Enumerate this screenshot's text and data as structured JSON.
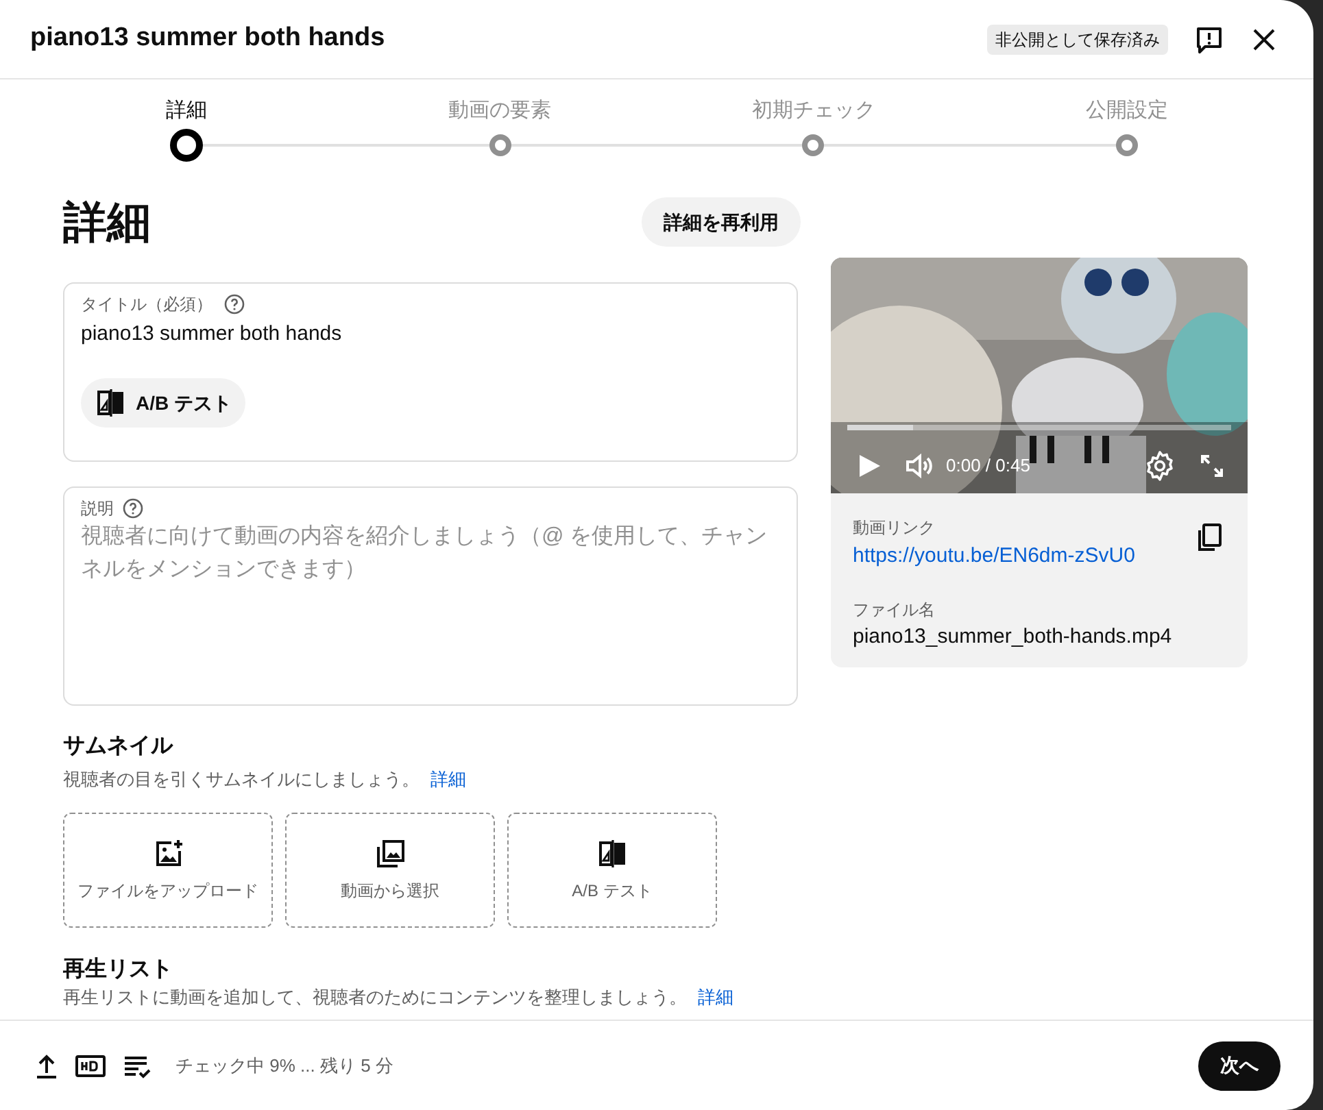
{
  "dialog": {
    "title": "piano13 summer both hands",
    "badge": "非公開として保存済み"
  },
  "steps": [
    {
      "label": "詳細",
      "selected": true
    },
    {
      "label": "動画の要素",
      "selected": false
    },
    {
      "label": "初期チェック",
      "selected": false
    },
    {
      "label": "公開設定",
      "selected": false
    }
  ],
  "heading": "詳細",
  "reuse_button": "詳細を再利用",
  "title_field": {
    "label": "タイトル（必須）",
    "value": "piano13 summer both hands",
    "ab_button": "A/B テスト"
  },
  "description_field": {
    "label": "説明",
    "placeholder": "視聴者に向けて動画の内容を紹介しましょう（@ を使用して、チャンネルをメンションできます）"
  },
  "video": {
    "time": "0:00 / 0:45",
    "progress": {
      "level": 0.17
    },
    "link_label": "動画リンク",
    "link": "https://youtu.be/EN6dm-zSvU0",
    "file_label": "ファイル名",
    "file_name": "piano13_summer_both-hands.mp4"
  },
  "thumbnail": {
    "heading": "サムネイル",
    "description": "視聴者の目を引くサムネイルにしましょう。",
    "more_link": "詳細",
    "options": [
      {
        "kind": "upload",
        "label": "ファイルをアップロード"
      },
      {
        "kind": "from_video",
        "label": "動画から選択"
      },
      {
        "kind": "ab_test",
        "label": "A/B テスト"
      }
    ]
  },
  "playlist": {
    "heading": "再生リスト",
    "description": "再生リストに動画を追加して、視聴者のためにコンテンツを整理しましょう。",
    "more_link": "詳細"
  },
  "status_bar": {
    "status": "チェック中 9% ... 残り 5 分",
    "next_button": "次へ"
  }
}
